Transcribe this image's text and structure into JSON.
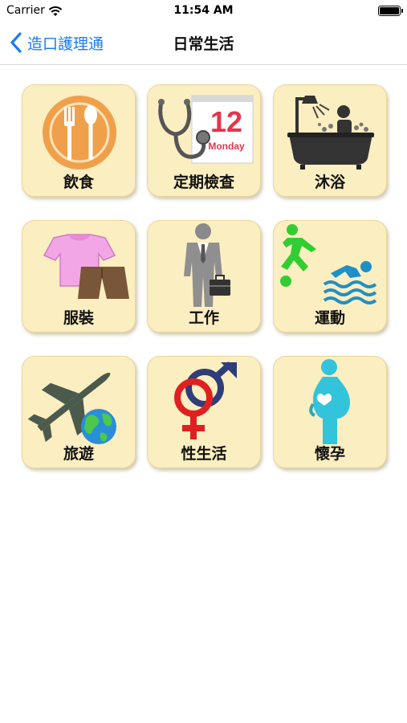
{
  "status_bar": {
    "carrier": "Carrier",
    "time": "11:54 AM"
  },
  "nav": {
    "back_label": "造口護理通",
    "title": "日常生活"
  },
  "tiles": [
    {
      "label": "飲食",
      "icon": "dining-icon"
    },
    {
      "label": "定期檢查",
      "icon": "checkup-icon",
      "calendar_day": "12",
      "calendar_weekday": "Monday"
    },
    {
      "label": "沐浴",
      "icon": "bath-icon"
    },
    {
      "label": "服裝",
      "icon": "clothing-icon"
    },
    {
      "label": "工作",
      "icon": "work-icon"
    },
    {
      "label": "運動",
      "icon": "sports-icon"
    },
    {
      "label": "旅遊",
      "icon": "travel-icon"
    },
    {
      "label": "性生活",
      "icon": "sex-life-icon"
    },
    {
      "label": "懷孕",
      "icon": "pregnancy-icon"
    }
  ],
  "colors": {
    "accent": "#1a7cf5",
    "tile_bg": "#fbeec0"
  }
}
